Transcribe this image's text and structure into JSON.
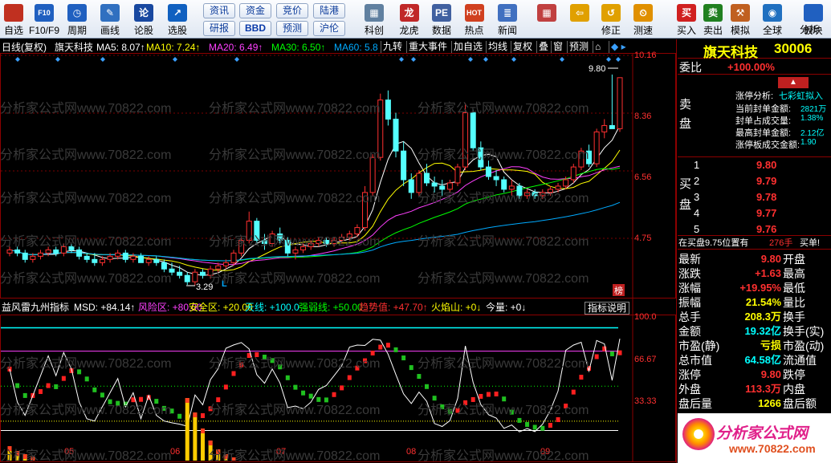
{
  "toolbar": {
    "items": [
      {
        "name": "self-select",
        "label": "自选",
        "icon": "",
        "color": "#c03020"
      },
      {
        "name": "f10",
        "label": "F10/F9",
        "icon": "F10",
        "color": "#2060c0"
      },
      {
        "name": "period",
        "label": "周期",
        "icon": "◷",
        "color": "#2060c0"
      },
      {
        "name": "draw-line",
        "label": "画线",
        "icon": "✎",
        "color": "#3070c0"
      },
      {
        "name": "stock-theory",
        "label": "论股",
        "icon": "论",
        "color": "#1848a0"
      },
      {
        "name": "stock-select",
        "label": "选股",
        "icon": "↗",
        "color": "#1060c0"
      },
      {
        "name": "tech-chart",
        "label": "科创",
        "icon": "▦",
        "color": "#6080a0"
      },
      {
        "name": "dragon-tiger",
        "label": "龙虎",
        "icon": "龙",
        "color": "#c02828"
      },
      {
        "name": "data",
        "label": "数据",
        "icon": "PE",
        "color": "#4060a0"
      },
      {
        "name": "hot-spot",
        "label": "热点",
        "icon": "HOT",
        "color": "#d04020"
      },
      {
        "name": "news",
        "label": "新闻",
        "icon": "≣",
        "color": "#4070c0"
      },
      {
        "name": "layout",
        "label": "",
        "icon": "▦",
        "color": "#c04040"
      },
      {
        "name": "back",
        "label": "",
        "icon": "⇦",
        "color": "#e0a000"
      },
      {
        "name": "revise",
        "label": "修正",
        "icon": "↺",
        "color": "#e0a000"
      },
      {
        "name": "measure",
        "label": "测速",
        "icon": "⏲",
        "color": "#e09000"
      },
      {
        "name": "buy",
        "label": "买入",
        "icon": "买",
        "color": "#d02020"
      },
      {
        "name": "sell",
        "label": "卖出",
        "icon": "卖",
        "color": "#208020"
      },
      {
        "name": "simulate",
        "label": "模拟",
        "icon": "⚒",
        "color": "#c06020"
      },
      {
        "name": "global",
        "label": "全球",
        "icon": "◉",
        "color": "#2070c0"
      },
      {
        "name": "sector",
        "label": "板块",
        "icon": "",
        "color": "#2060c0"
      }
    ],
    "small_buttons": [
      "资讯",
      "资金",
      "竞价",
      "陆港",
      "研报",
      "BBD",
      "预测",
      "沪伦"
    ],
    "sector_sub": "分析"
  },
  "chart": {
    "title": "日线(复权)",
    "stock": "旗天科技",
    "ma_labels": [
      {
        "text": "MA5: 8.07↑",
        "color": "#ffffff"
      },
      {
        "text": "MA10: 7.24↑",
        "color": "#ffff00"
      },
      {
        "text": "MA20: 6.49↑",
        "color": "#ff40ff"
      },
      {
        "text": "MA30: 6.50↑",
        "color": "#00ff00"
      },
      {
        "text": "MA60: 5.8",
        "color": "#00aaff"
      }
    ],
    "top_buttons": [
      "九转",
      "重大事件",
      "加自选",
      "均线",
      "复权",
      "叠",
      "窗",
      "预测"
    ],
    "price_labels": [
      "10.16",
      "8.36",
      "6.56",
      "4.75"
    ],
    "high_label": "9.80",
    "low_label": "3.29",
    "low_marker": "L",
    "rank_badge": "榜",
    "indicator": {
      "name": "益风雷九州指标",
      "items": [
        {
          "text": "MSD: +84.14↑",
          "color": "#ffffff"
        },
        {
          "text": "风险区: +80.00",
          "color": "#ff40ff"
        },
        {
          "text": "安全区: +20.00",
          "color": "#ffff00"
        },
        {
          "text": "天线: +100.0",
          "color": "#00ffff"
        },
        {
          "text": "强弱线: +50.00",
          "color": "#00ff00"
        },
        {
          "text": "趋势值: +47.70↑",
          "color": "#ff3030"
        },
        {
          "text": "火焰山: +0↓",
          "color": "#ffff00"
        },
        {
          "text": "今量: +0↓",
          "color": "#ffffff"
        }
      ],
      "help": "指标说明",
      "levels": [
        "100.0",
        "66.67",
        "33.33"
      ]
    },
    "months": [
      "05",
      "06",
      "07",
      "08",
      "09"
    ],
    "watermark": "分析家公式网www.70822.com",
    "chart_data": {
      "type": "candlestick",
      "ylim": [
        2.9,
        10.5
      ],
      "candles": [
        [
          4.3,
          4.5,
          4.2,
          4.4
        ],
        [
          4.4,
          4.5,
          4.2,
          4.3
        ],
        [
          4.3,
          4.4,
          4.0,
          4.1
        ],
        [
          4.1,
          4.3,
          4.0,
          4.2
        ],
        [
          4.2,
          4.4,
          4.1,
          4.3
        ],
        [
          4.3,
          4.5,
          4.2,
          4.4
        ],
        [
          4.4,
          4.5,
          4.2,
          4.3
        ],
        [
          4.3,
          4.6,
          4.2,
          4.5
        ],
        [
          4.5,
          4.6,
          4.3,
          4.4
        ],
        [
          4.4,
          4.5,
          4.1,
          4.2
        ],
        [
          4.2,
          4.3,
          4.0,
          4.1
        ],
        [
          4.1,
          4.3,
          3.9,
          4.0
        ],
        [
          4.0,
          4.2,
          3.9,
          4.1
        ],
        [
          4.1,
          4.3,
          4.0,
          4.2
        ],
        [
          4.2,
          4.4,
          4.1,
          4.3
        ],
        [
          4.3,
          4.4,
          4.0,
          4.1
        ],
        [
          4.1,
          4.3,
          4.0,
          4.2
        ],
        [
          4.2,
          4.3,
          4.0,
          4.0
        ],
        [
          4.0,
          4.2,
          3.9,
          4.1
        ],
        [
          4.1,
          4.2,
          3.9,
          4.0
        ],
        [
          4.0,
          4.1,
          3.7,
          3.8
        ],
        [
          3.8,
          4.0,
          3.6,
          3.7
        ],
        [
          3.7,
          3.9,
          3.5,
          3.6
        ],
        [
          3.6,
          3.7,
          3.3,
          3.4
        ],
        [
          3.4,
          3.8,
          3.29,
          3.7
        ],
        [
          3.7,
          3.8,
          3.5,
          3.6
        ],
        [
          3.6,
          3.9,
          3.5,
          3.8
        ],
        [
          3.8,
          4.0,
          3.7,
          3.9
        ],
        [
          3.9,
          4.1,
          3.8,
          4.0
        ],
        [
          4.0,
          4.4,
          3.9,
          4.3
        ],
        [
          4.3,
          4.8,
          4.2,
          4.7
        ],
        [
          4.7,
          5.6,
          4.6,
          5.3
        ],
        [
          5.3,
          5.4,
          4.6,
          4.7
        ],
        [
          4.7,
          4.9,
          4.4,
          4.6
        ],
        [
          4.6,
          5.0,
          4.5,
          4.9
        ],
        [
          4.9,
          5.1,
          4.6,
          4.7
        ],
        [
          4.7,
          4.8,
          4.2,
          4.3
        ],
        [
          4.3,
          4.5,
          4.1,
          4.4
        ],
        [
          4.4,
          4.6,
          4.3,
          4.5
        ],
        [
          4.5,
          4.7,
          4.4,
          4.6
        ],
        [
          4.6,
          4.8,
          4.5,
          4.7
        ],
        [
          4.7,
          4.8,
          4.5,
          4.6
        ],
        [
          4.6,
          4.8,
          4.5,
          4.7
        ],
        [
          4.7,
          4.9,
          4.6,
          4.8
        ],
        [
          4.8,
          5.0,
          4.7,
          4.9
        ],
        [
          4.9,
          5.2,
          4.8,
          5.1
        ],
        [
          5.1,
          6.4,
          5.0,
          6.2
        ],
        [
          6.2,
          7.4,
          6.1,
          7.3
        ],
        [
          7.3,
          9.3,
          7.2,
          9.1
        ],
        [
          9.1,
          9.4,
          8.3,
          8.5
        ],
        [
          8.5,
          8.7,
          7.3,
          7.5
        ],
        [
          7.5,
          7.8,
          6.4,
          6.6
        ],
        [
          6.6,
          6.8,
          6.0,
          6.2
        ],
        [
          6.2,
          6.9,
          6.1,
          6.8
        ],
        [
          6.8,
          7.1,
          6.4,
          6.5
        ],
        [
          6.5,
          6.7,
          6.2,
          6.4
        ],
        [
          6.4,
          6.6,
          6.1,
          6.3
        ],
        [
          6.3,
          6.6,
          6.2,
          6.5
        ],
        [
          6.5,
          7.1,
          6.4,
          7.0
        ],
        [
          7.0,
          9.0,
          6.9,
          8.7
        ],
        [
          8.7,
          8.8,
          7.5,
          7.6
        ],
        [
          7.6,
          7.8,
          6.9,
          7.0
        ],
        [
          7.0,
          7.2,
          6.6,
          6.7
        ],
        [
          6.7,
          6.9,
          6.4,
          6.6
        ],
        [
          6.6,
          6.7,
          6.2,
          6.3
        ],
        [
          6.3,
          6.6,
          6.1,
          6.4
        ],
        [
          6.4,
          6.5,
          6.0,
          6.1
        ],
        [
          6.1,
          6.3,
          6.0,
          6.2
        ],
        [
          6.2,
          6.3,
          6.0,
          6.1
        ],
        [
          6.1,
          6.3,
          6.0,
          6.2
        ],
        [
          6.2,
          6.4,
          6.1,
          6.3
        ],
        [
          6.3,
          6.5,
          6.2,
          6.4
        ],
        [
          6.4,
          6.7,
          6.3,
          6.6
        ],
        [
          6.6,
          7.1,
          6.5,
          7.0
        ],
        [
          7.0,
          7.6,
          6.9,
          7.5
        ],
        [
          7.5,
          7.7,
          7.0,
          7.1
        ],
        [
          7.1,
          8.2,
          7.0,
          8.1
        ],
        [
          8.1,
          8.5,
          7.9,
          8.3
        ],
        [
          8.3,
          9.9,
          8.2,
          8.2
        ],
        [
          8.2,
          9.8,
          8.1,
          9.8
        ]
      ]
    }
  },
  "sidebar": {
    "stock_name": "旗天科技",
    "code": "30006",
    "weibi_label": "委比",
    "weibi_value": "+100.00%",
    "analysis_title": "涨停分析:",
    "analysis_tag": "七彩虹拟入",
    "analysis_rows": [
      {
        "k": "当前封单金额:",
        "v": "2821万"
      },
      {
        "k": "封单占成交量:",
        "v": "1.38%"
      },
      {
        "k": "最高封单金额:",
        "v": "2.12亿"
      },
      {
        "k": "涨停板成交金额:",
        "v": "1.90"
      }
    ],
    "sell_label": "卖盘",
    "buy_label": "买盘",
    "bids": [
      {
        "n": "1",
        "p": "9.80"
      },
      {
        "n": "2",
        "p": "9.79"
      },
      {
        "n": "3",
        "p": "9.78"
      },
      {
        "n": "4",
        "p": "9.77"
      },
      {
        "n": "5",
        "p": "9.76"
      }
    ],
    "queue_text": "在买盘9.75位置有",
    "queue_qty": "276手",
    "queue_action": "买单!",
    "stats": [
      {
        "k": "最新",
        "v": "9.80",
        "c": "#ff3030",
        "k2": "开盘"
      },
      {
        "k": "涨跌",
        "v": "+1.63",
        "c": "#ff3030",
        "k2": "最高"
      },
      {
        "k": "涨幅",
        "v": "+19.95%",
        "c": "#ff3030",
        "k2": "最低"
      },
      {
        "k": "振幅",
        "v": "21.54%",
        "c": "#ffff00",
        "k2": "量比"
      },
      {
        "k": "总手",
        "v": "208.3万",
        "c": "#ffff00",
        "k2": "换手"
      },
      {
        "k": "金额",
        "v": "19.32亿",
        "c": "#00ffff",
        "k2": "换手(实)"
      },
      {
        "k": "市盈(静)",
        "v": "亏损",
        "c": "#ffff00",
        "k2": "市盈(动)"
      },
      {
        "k": "总市值",
        "v": "64.58亿",
        "c": "#00ffff",
        "k2": "流通值"
      },
      {
        "k": "涨停",
        "v": "9.80",
        "c": "#ff3030",
        "k2": "跌停"
      },
      {
        "k": "外盘",
        "v": "113.3万",
        "c": "#ff3030",
        "k2": "内盘"
      },
      {
        "k": "盘后量",
        "v": "1266",
        "c": "#ffff00",
        "k2": "盘后额"
      }
    ],
    "logo_text": "分析家公式网",
    "logo_url": "www.70822.com"
  }
}
